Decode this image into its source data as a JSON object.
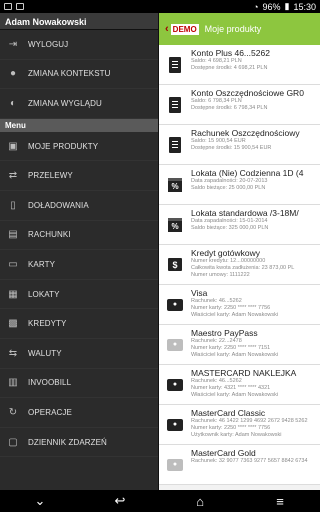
{
  "status_bar": {
    "battery": "96%",
    "time": "15:30"
  },
  "drawer": {
    "user_name": "Adam Nowakowski",
    "top_items": [
      {
        "label": "WYLOGUJ",
        "icon": "logout-icon"
      },
      {
        "label": "ZMIANA KONTEKSTU",
        "icon": "person-icon"
      },
      {
        "label": "ZMIANA WYGLĄDU",
        "icon": "palette-icon"
      }
    ],
    "menu_header": "Menu",
    "menu_items": [
      {
        "label": "MOJE PRODUKTY",
        "icon": "wallet-icon"
      },
      {
        "label": "PRZELEWY",
        "icon": "transfer-icon"
      },
      {
        "label": "DOŁADOWANIA",
        "icon": "phone-icon"
      },
      {
        "label": "RACHUNKI",
        "icon": "image-icon"
      },
      {
        "label": "KARTY",
        "icon": "card-icon"
      },
      {
        "label": "LOKATY",
        "icon": "calendar-icon"
      },
      {
        "label": "KREDYTY",
        "icon": "briefcase-icon"
      },
      {
        "label": "WALUTY",
        "icon": "exchange-icon"
      },
      {
        "label": "INVOOBILL",
        "icon": "invoice-icon"
      },
      {
        "label": "OPERACJE",
        "icon": "refresh-icon"
      },
      {
        "label": "DZIENNIK ZDARZEŃ",
        "icon": "log-icon"
      }
    ]
  },
  "panel": {
    "demo_label": "DEMO",
    "title": "Moje produkty",
    "accounts": [
      {
        "name": "Konto Plus 46...5262",
        "lines": [
          "Saldo: 4 698,21 PLN",
          "Dostępne środki: 4 698,21 PLN"
        ],
        "icon": "document-icon",
        "type": "doc"
      },
      {
        "name": "Konto Oszczędnościowe GR0",
        "lines": [
          "Saldo: 6 798,34 PLN",
          "Dostępne środki: 6 798,34 PLN"
        ],
        "icon": "document-icon",
        "type": "doc"
      },
      {
        "name": "Rachunek Oszczędnościowy",
        "lines": [
          "Saldo: 15 900,54 EUR",
          "Dostępne środki: 15 900,54 EUR"
        ],
        "icon": "document-icon",
        "type": "doc"
      },
      {
        "name": "Lokata (Nie) Codzienna 1D (4",
        "lines": [
          "Data zapadalności: 20-07-2013",
          "Saldo bieżące: 25 000,00 PLN"
        ],
        "icon": "calendar-percent-icon",
        "type": "cal"
      },
      {
        "name": "Lokata standardowa /3-18M/",
        "lines": [
          "Data zapadalności: 15-01-2014",
          "Saldo bieżące: 325 000,00 PLN"
        ],
        "icon": "calendar-percent-icon",
        "type": "cal"
      },
      {
        "name": "Kredyt gotówkowy",
        "lines": [
          "Numer kredytu: 12...00000000",
          "Całkowita kwota zadłużenia: 23 873,00 PL",
          "Numer umowy: 1111222"
        ],
        "icon": "dollar-bag-icon",
        "type": "bag"
      },
      {
        "name": "Visa",
        "lines": [
          "Rachunek: 46...5262",
          "Numer karty: 2250 **** **** 7756",
          "Właściciel karty: Adam Nowakowski"
        ],
        "icon": "credit-card-icon",
        "type": "card"
      },
      {
        "name": "Maestro PayPass",
        "lines": [
          "Rachunek: 22...2478",
          "Numer karty: 2250 **** **** 7151",
          "Właściciel karty: Adam Nowakowski"
        ],
        "icon": "credit-card-icon",
        "type": "card-light"
      },
      {
        "name": "MASTERCARD NAKLEJKA",
        "lines": [
          "Rachunek: 46...5262",
          "Numer karty: 4321 **** **** 4321",
          "Właściciel karty: Adam Nowakowski"
        ],
        "icon": "credit-card-icon",
        "type": "card"
      },
      {
        "name": "MasterCard Classic",
        "lines": [
          "Rachunek: 46 1422 1299 4692 2672 9428 5262",
          "Numer karty: 2250 **** **** 7756",
          "Użytkownik karty: Adam Nowakowski"
        ],
        "icon": "credit-card-icon",
        "type": "card"
      },
      {
        "name": "MasterCard Gold",
        "lines": [
          "Rachunek: 32 9077 7363 9277 5657 8842 6734"
        ],
        "icon": "credit-card-icon",
        "type": "card-light"
      }
    ]
  }
}
